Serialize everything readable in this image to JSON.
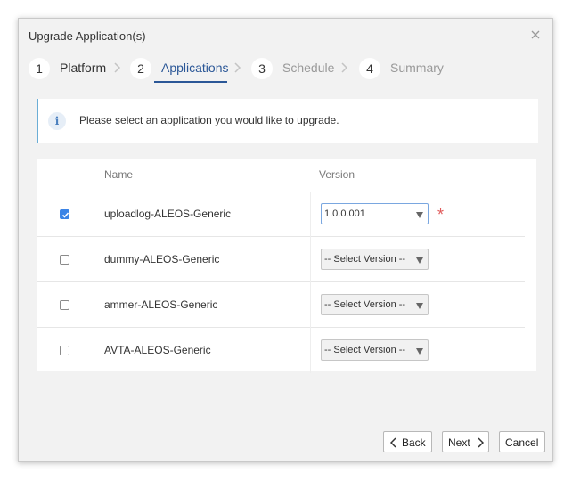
{
  "dialog": {
    "title": "Upgrade Application(s)"
  },
  "icons": {
    "close": "close-icon",
    "info": "info-icon",
    "chevron": "chevron-right-icon",
    "checkmark": "checkmark-icon",
    "caret": "caret-down-icon"
  },
  "stepper": {
    "steps": [
      {
        "number": "1",
        "label": "Platform",
        "state": "done"
      },
      {
        "number": "2",
        "label": "Applications",
        "state": "active"
      },
      {
        "number": "3",
        "label": "Schedule",
        "state": "future"
      },
      {
        "number": "4",
        "label": "Summary",
        "state": "future"
      }
    ]
  },
  "info": {
    "icon_glyph": "i",
    "message": "Please select an application you would like to upgrade."
  },
  "table": {
    "columns": {
      "name": "Name",
      "version": "Version"
    },
    "rows": [
      {
        "name": "uploadlog-ALEOS-Generic",
        "checked": true,
        "version": "1.0.0.001",
        "required_mark": "*"
      },
      {
        "name": "dummy-ALEOS-Generic",
        "checked": false,
        "version": "-- Select Version --"
      },
      {
        "name": "ammer-ALEOS-Generic",
        "checked": false,
        "version": "-- Select Version --"
      },
      {
        "name": "AVTA-ALEOS-Generic",
        "checked": false,
        "version": "-- Select Version --"
      }
    ]
  },
  "footer": {
    "back_label": "Back",
    "next_label": "Next",
    "cancel_label": "Cancel"
  },
  "colors": {
    "accent": "#2b5797",
    "checkbox_checked": "#3b84e6",
    "required": "#e05a5a",
    "info_border": "#6baed6"
  }
}
